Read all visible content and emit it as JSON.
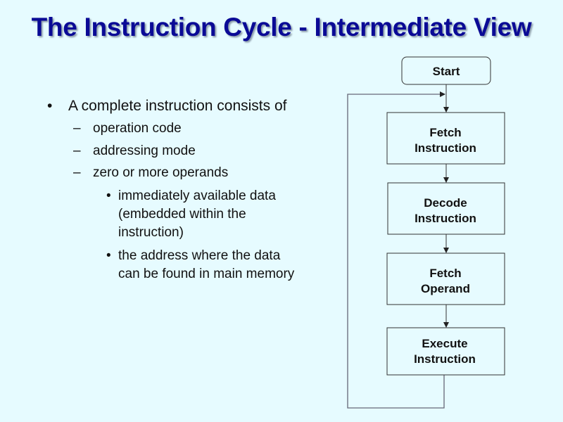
{
  "slide": {
    "title": "The Instruction Cycle - Intermediate View",
    "background_color": "#e6fbff",
    "title_color": "#0a0a96"
  },
  "bullets": {
    "level1": {
      "marker": "•",
      "text": "A complete instruction consists of"
    },
    "level2": [
      {
        "marker": "–",
        "text": "operation code"
      },
      {
        "marker": "–",
        "text": "addressing mode"
      },
      {
        "marker": "–",
        "text": "zero or more operands"
      }
    ],
    "level3": [
      {
        "marker": "•",
        "lines": [
          "immediately available data",
          "(embedded within the",
          "instruction)"
        ]
      },
      {
        "marker": "•",
        "lines": [
          "the address where the data",
          "can be found in main memory"
        ]
      }
    ]
  },
  "flowchart": {
    "start": {
      "label": "Start",
      "shape": "rounded-rectangle"
    },
    "steps": [
      {
        "lines": [
          "Fetch",
          "Instruction"
        ]
      },
      {
        "lines": [
          "Decode",
          "Instruction"
        ]
      },
      {
        "lines": [
          "Fetch",
          "Operand"
        ]
      },
      {
        "lines": [
          "Execute",
          "Instruction"
        ]
      }
    ],
    "loop": "Execute Instruction returns to Fetch Instruction"
  }
}
